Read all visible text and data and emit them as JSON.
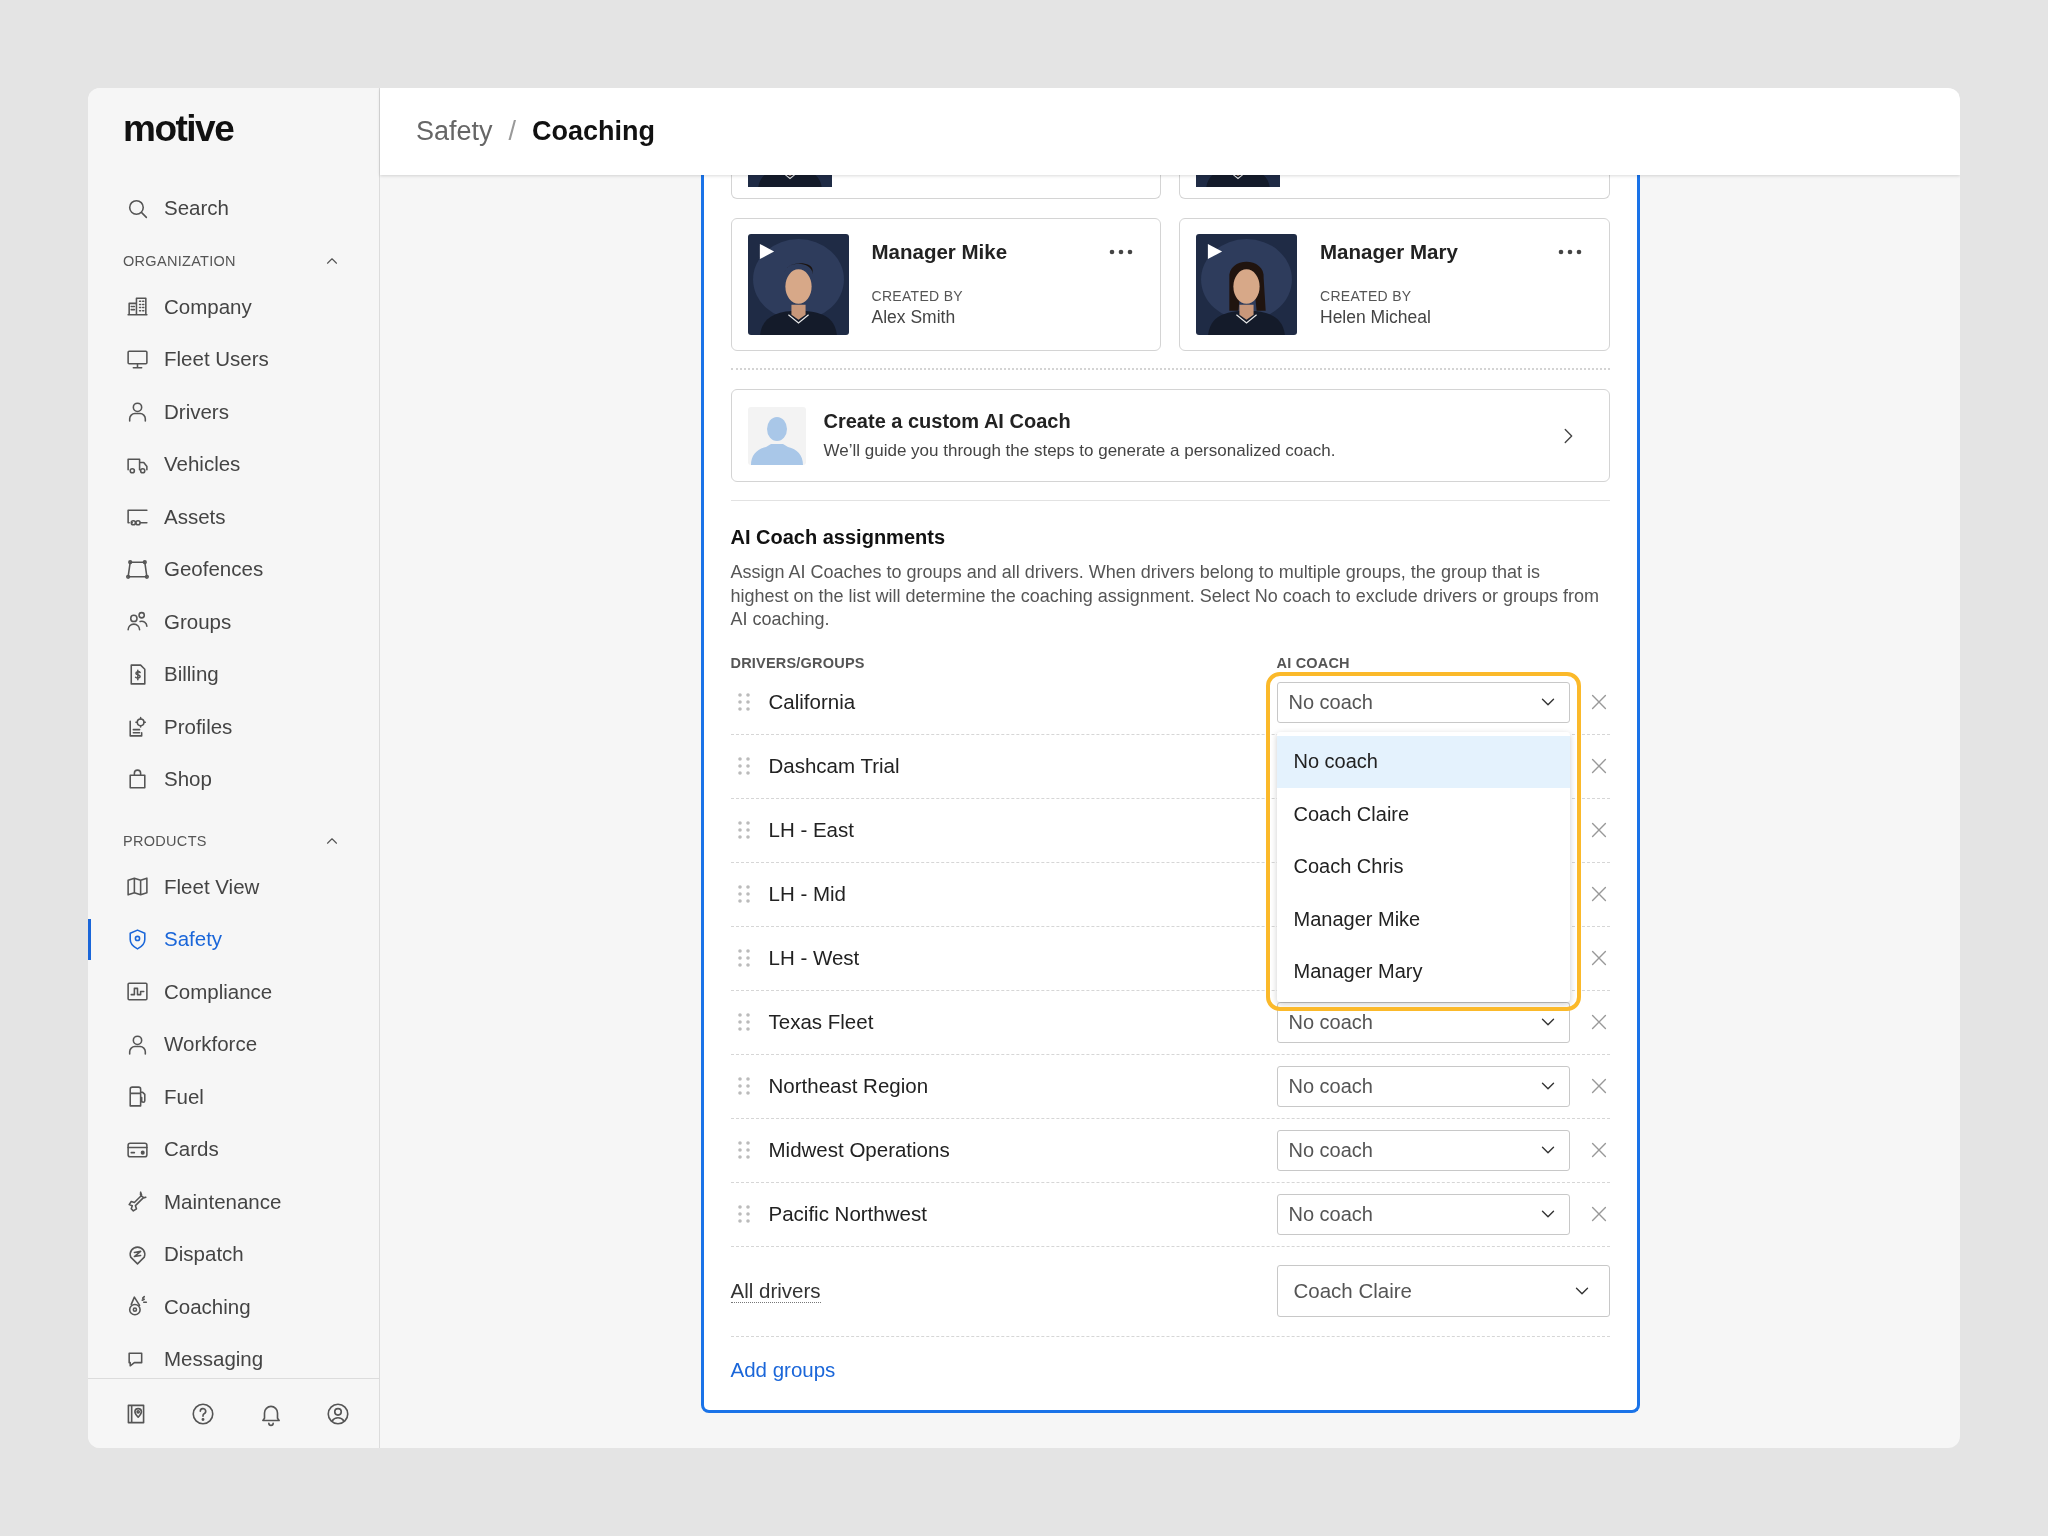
{
  "sidebar": {
    "logo": "motive",
    "search": "Search",
    "sections": [
      {
        "title": "ORGANIZATION",
        "expanded": true,
        "items": [
          {
            "label": "Company",
            "selected": false
          },
          {
            "label": "Fleet Users",
            "selected": false
          },
          {
            "label": "Drivers",
            "selected": false
          },
          {
            "label": "Vehicles",
            "selected": false
          },
          {
            "label": "Assets",
            "selected": false
          },
          {
            "label": "Geofences",
            "selected": false
          },
          {
            "label": "Groups",
            "selected": false
          },
          {
            "label": "Billing",
            "selected": false
          },
          {
            "label": "Profiles",
            "selected": false
          },
          {
            "label": "Shop",
            "selected": false
          }
        ]
      },
      {
        "title": "PRODUCTS",
        "expanded": true,
        "items": [
          {
            "label": "Fleet View",
            "selected": false
          },
          {
            "label": "Safety",
            "selected": true
          },
          {
            "label": "Compliance",
            "selected": false
          },
          {
            "label": "Workforce",
            "selected": false
          },
          {
            "label": "Fuel",
            "selected": false
          },
          {
            "label": "Cards",
            "selected": false
          },
          {
            "label": "Maintenance",
            "selected": false
          },
          {
            "label": "Dispatch",
            "selected": false
          },
          {
            "label": "Coaching",
            "selected": false
          },
          {
            "label": "Messaging",
            "selected": false
          }
        ]
      }
    ]
  },
  "header": {
    "breadcrumb": [
      {
        "label": "Safety",
        "current": false
      },
      {
        "label": "Coaching",
        "current": true
      }
    ],
    "separator": "/"
  },
  "coaches": [
    {
      "name": "Manager Mike",
      "created_label": "CREATED BY",
      "creator": "Alex Smith"
    },
    {
      "name": "Manager Mary",
      "created_label": "CREATED BY",
      "creator": "Helen Micheal"
    }
  ],
  "custom_coach": {
    "title": "Create a custom AI Coach",
    "subtitle": "We’ll guide you through the steps to generate a personalized coach."
  },
  "assignments": {
    "title": "AI Coach assignments",
    "description": "Assign AI Coaches to groups and all drivers. When drivers belong to multiple groups, the group that is highest on the list will determine the coaching assignment. Select No coach to exclude drivers or groups from AI coaching.",
    "columns": [
      "DRIVERS/GROUPS",
      "AI COACH"
    ],
    "rows": [
      {
        "name": "California",
        "coach": "No coach",
        "menu": {
          "highlighted": true,
          "options": [
            {
              "label": "No coach",
              "selected": true
            },
            {
              "label": "Coach Claire",
              "selected": false
            },
            {
              "label": "Coach Chris",
              "selected": false
            },
            {
              "label": "Manager Mike",
              "selected": false
            },
            {
              "label": "Manager Mary",
              "selected": false
            }
          ]
        }
      },
      {
        "name": "Dashcam Trial"
      },
      {
        "name": "LH - East"
      },
      {
        "name": "LH - Mid"
      },
      {
        "name": "LH - West"
      },
      {
        "name": "Texas Fleet",
        "coach": "No coach"
      },
      {
        "name": "Northeast Region",
        "coach": "No coach"
      },
      {
        "name": "Midwest Operations",
        "coach": "No coach"
      },
      {
        "name": "Pacific Northwest",
        "coach": "No coach"
      }
    ],
    "all_drivers": {
      "label": "All drivers",
      "coach": "Coach Claire"
    },
    "add_link": "Add groups"
  }
}
